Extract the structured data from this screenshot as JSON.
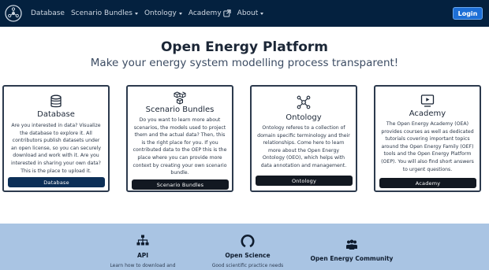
{
  "nav": {
    "items": [
      {
        "label": "Database",
        "dropdown": false
      },
      {
        "label": "Scenario Bundles",
        "dropdown": true
      },
      {
        "label": "Ontology",
        "dropdown": true
      },
      {
        "label": "Academy",
        "dropdown": false,
        "external": true
      },
      {
        "label": "About",
        "dropdown": true
      }
    ],
    "login_label": "Login"
  },
  "hero": {
    "title": "Open Energy Platform",
    "subtitle": "Make your energy system modelling process transparent!"
  },
  "cards": [
    {
      "icon": "database-icon",
      "title": "Database",
      "text": "Are you interested in data? Visualize the database to explore it. All contributors publish datasets under an open license, so you can securely download and work with it. Are you interested in sharing your own data? This is the place to upload it.",
      "button": "Database"
    },
    {
      "icon": "cubes-icon",
      "title": "Scenario Bundles",
      "text": "Do you want to learn more about scenarios, the models used to project them and the actual data? Then, this is the right place for you. If you contributed data to the OEP this is the place where you can provide more context by creating your own scenario bundle.",
      "button": "Scenario Bundles"
    },
    {
      "icon": "network-icon",
      "title": "Ontology",
      "text": "Ontology referes to a collection of domain specific terminology and their relationships. Come here to learn more about the Open Energy Ontology (OEO), which helps with data annotation and management.",
      "button": "Ontology"
    },
    {
      "icon": "monitor-play-icon",
      "title": "Academy",
      "text": "The Open Energy Academy (OEA) provides courses as well as dedicated tutorials covering important topics around the Open Energy Family (OEF) tools and the Open Energy Platform (OEP). You will also find short answers to urgent questions.",
      "button": "Academy"
    }
  ],
  "band": {
    "items": [
      {
        "icon": "api-tree-icon",
        "title": "API",
        "text": "Learn how to download and"
      },
      {
        "icon": "open-science-icon",
        "title": "Open Science",
        "text": "Good scientific practice needs"
      },
      {
        "icon": "community-icon",
        "title": "Open Energy Community",
        "text": ""
      }
    ]
  },
  "colors": {
    "navbar": "#04213f",
    "login": "#1d6fd6",
    "button_blue": "#0c2f57",
    "button_dark": "#121821",
    "band": "#a9c4e3"
  }
}
